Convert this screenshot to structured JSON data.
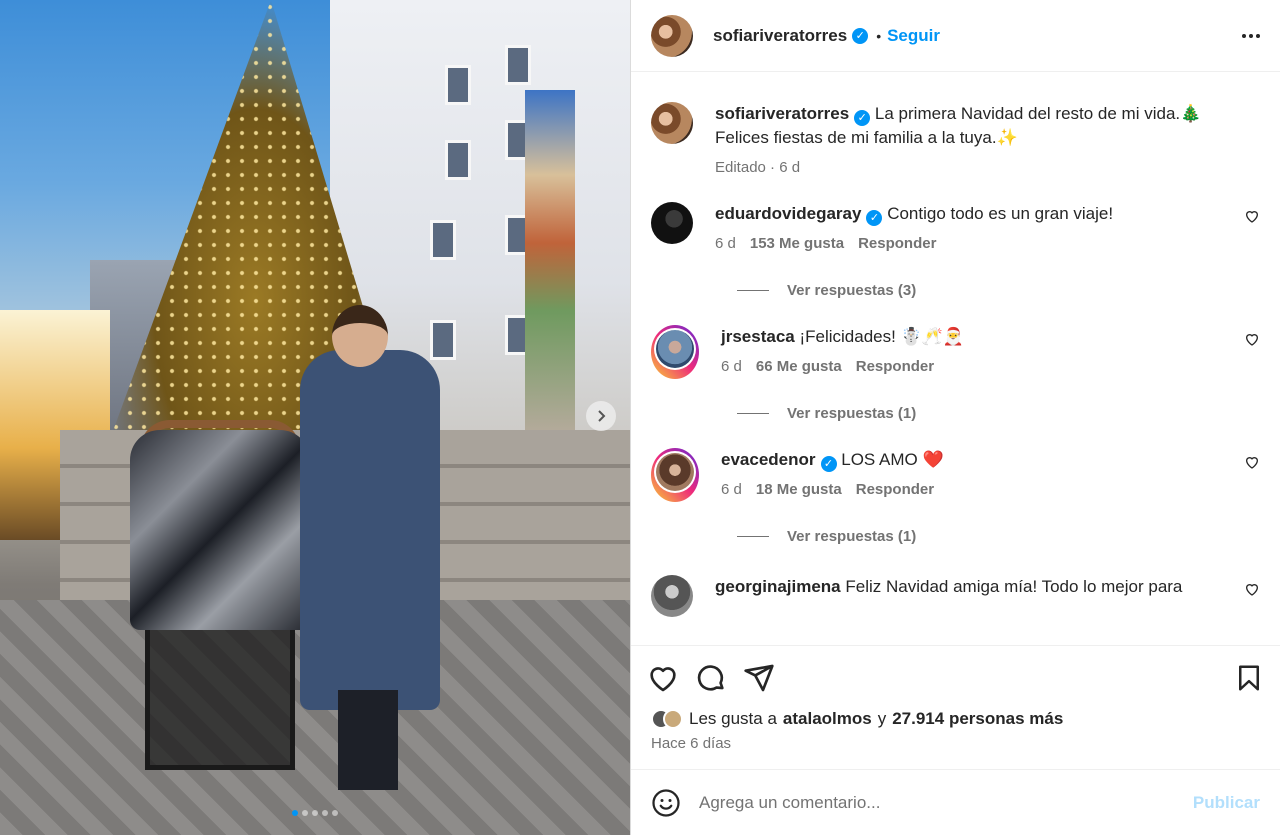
{
  "post": {
    "username": "sofiariveratorres",
    "follow_label": "Seguir",
    "bullet": "•",
    "caption_line1": "La primera Navidad del resto de mi vida.🎄",
    "caption_line2": "Felices fiestas de mi familia a la tuya.✨",
    "caption_meta": "Editado · 6 d",
    "carousel_current": 1,
    "carousel_total": 5
  },
  "comments": [
    {
      "username": "eduardovidegaray",
      "verified": true,
      "text": "Contigo todo es un gran viaje!",
      "time": "6 d",
      "likes": "153 Me gusta",
      "reply": "Responder",
      "view_replies": "Ver respuestas (3)"
    },
    {
      "username": "jrsestaca",
      "verified": false,
      "text": "¡Felicidades! ☃️🥂🎅",
      "time": "6 d",
      "likes": "66 Me gusta",
      "reply": "Responder",
      "view_replies": "Ver respuestas (1)"
    },
    {
      "username": "evacedenor",
      "verified": true,
      "text": "LOS AMO ❤️",
      "time": "6 d",
      "likes": "18 Me gusta",
      "reply": "Responder",
      "view_replies": "Ver respuestas (1)"
    },
    {
      "username": "georginajimena",
      "verified": false,
      "text": "Feliz Navidad amiga mía! Todo lo mejor para"
    }
  ],
  "likes": {
    "prefix": "Les gusta a",
    "user": "atalaolmos",
    "joiner": "y",
    "others": "27.914 personas más",
    "time": "Hace 6 días"
  },
  "composer": {
    "placeholder": "Agrega un comentario...",
    "publish_label": "Publicar"
  },
  "colors": {
    "accent": "#0095f6",
    "publish_disabled": "#b2dffc",
    "muted": "#737373"
  }
}
